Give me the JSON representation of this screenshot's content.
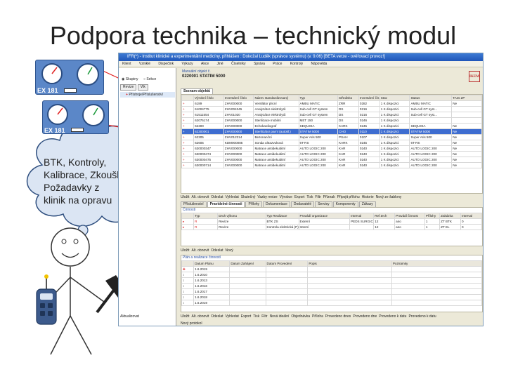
{
  "slide": {
    "title": "Podpora technika – technický modul",
    "cloud_lines": [
      "BTK, Kontroly,",
      "Kalibrace, Zkoušky,",
      "Požadavky z",
      "klinik na opravu"
    ]
  },
  "devices": [
    {
      "label": "EX 181"
    },
    {
      "label": "EX 181"
    }
  ],
  "colors": {
    "device_blue": "#5b87c8",
    "arrow_red": "#e02020",
    "selected_row": "#3e6dd0",
    "titlebar": "#1f55b8"
  },
  "app": {
    "title": "IFR(*) - Institut klinické a experimentální medicíny, přihlášen : Dokožal Luděk (správce systému) (v. 9.06) [BETA verze - ověřovací provoz!]",
    "menu": [
      "Klient",
      "Vzniklé",
      "Dispečink",
      "Výkazy",
      "Akce",
      "Jiné",
      "Číselníky",
      "Správa",
      "Práce",
      "Kontroly",
      "Nápověda"
    ],
    "radio_options": [
      "Skupiny",
      "Sekce"
    ],
    "left_tabs": [
      "Revize",
      "Vtk"
    ],
    "left_item": "Přístroje/Příslušenství",
    "header_label": "Manuální objekt č.",
    "header_value": "0220001 STATIM 5000",
    "logo_text": "IKEM",
    "upper_tab": "Seznam objektů",
    "upper_columns": [
      "Výrobní číslo",
      "Inventární číslo",
      "Název standardizovaný",
      "Typ",
      "Středisko",
      "Inventární čís.",
      "Stav",
      "Status",
      "TAss ZP"
    ],
    "upper_rows": [
      [
        "6189",
        "ZHV000000",
        "Ventilátor plicní",
        "AMBU MATIC",
        "ZRR",
        "0282",
        "1 K dispozici",
        "AMBU MATIC",
        "Ne"
      ],
      [
        "61004775",
        "ZHV004345",
        "Analyzátor elektrolytů",
        "Sub-cell GT system",
        "DS",
        "0216",
        "1 K dispozici",
        "Sub-cell GT syst...",
        ""
      ],
      [
        "61511554",
        "ZHV01020",
        "Analyzátor elektrolytů",
        "Sub-cell GT system",
        "DS",
        "0216",
        "1 K dispozici",
        "Sub-cell GT syst...",
        ""
      ],
      [
        "62075174",
        "ZHV000000",
        "Sterilizace mobilní",
        "MET 150",
        "DS",
        "0246",
        "1 K dispozici",
        "",
        ""
      ],
      [
        "62300",
        "ZHV000000",
        "Echokardiograf",
        "SEQUOIA",
        "KARK",
        "0245",
        "1 K dispozici",
        "SEQUOIA",
        "Ne"
      ],
      [
        "62300001",
        "ZHV000000",
        "Sterilizátor parní (autokl.)",
        "STATIM 5000",
        "CHO",
        "0110",
        "1 K dispozici",
        "STATIM 5000",
        "Ne"
      ],
      [
        "62305",
        "ZHV012314",
        "Bezonanční",
        "Super Aris 500",
        "PSAH",
        "0107",
        "1 K dispozici",
        "Super Aris 500",
        "Ne"
      ],
      [
        "62605",
        "KDM000085",
        "Sonda ultrazvuková",
        "6T-RS",
        "KARK",
        "0245",
        "1 K dispozici",
        "6T-RS",
        "Ne"
      ],
      [
        "630000347",
        "ZHV000000",
        "Matrace antidekubitní",
        "AUTO LOGIC 200",
        "KAR",
        "0240",
        "1 K dispozici",
        "AUTO LOGIC 200",
        "Ne"
      ],
      [
        "630000474",
        "ZHV000000",
        "Matrace antidekubitní",
        "AUTO LOGIC 200",
        "KAR",
        "0240",
        "1 K dispozici",
        "AUTO LOGIC 200",
        "Ne"
      ],
      [
        "630000475",
        "ZHV000000",
        "Matrace antidekubitní",
        "AUTO LOGIC 200",
        "KAR",
        "0240",
        "1 K dispozici",
        "AUTO LOGIC 200",
        "Ne"
      ],
      [
        "630000714",
        "ZHV000000",
        "Matrace antidekubitní",
        "AUTO LOGIC 200",
        "KAR",
        "0240",
        "1 K dispozici",
        "AUTO LOGIC 200",
        "Ne"
      ]
    ],
    "upper_selected": 5,
    "upper_toolbar": [
      "Uložit",
      "Alt. obnovit",
      "Odeslat",
      "Vyhledat",
      "Skutečný",
      "Vazby revize",
      "Výrobce",
      "Export",
      "Tisk",
      "Filtr",
      "Příznak",
      "Připojit přílohu",
      "Historie",
      "Nový ze šablony"
    ],
    "lower_tabs": [
      "Příslušenství",
      "Pravidelné činnosti",
      "Přílohy",
      "Dokumentace",
      "Dodavatelé",
      "Servisy",
      "Komponenty",
      "Zákazy"
    ],
    "lower_active_tab": 1,
    "lower_group": "Činnosti",
    "lower_columns": [
      "Typ",
      "Druh výkonu",
      "Typ Realizace",
      "Provádí organizace",
      "Interval",
      "Ref.tech",
      "Provádí činnost",
      "Přílohy",
      "Zakázka",
      "Interval"
    ],
    "lower_rows": [
      [
        "R",
        "Revize",
        "BTK ZS",
        "Externí",
        "PEDS SURGICAL s.r.o.",
        "12",
        "ano",
        "1",
        "ZT BTK",
        "0"
      ],
      [
        "R",
        "Revize",
        "Kontrola elektrická (P)",
        "Interní",
        "",
        "12",
        "ano",
        "1",
        "ZT EL",
        "0"
      ]
    ],
    "lower_toolbar": [
      "Uložit",
      "Alt. obnovit",
      "Odeslat",
      "Nový"
    ],
    "plan_group": "Plán a realizace činností",
    "plan_columns": [
      "Datum Plánu",
      "Datum Zahájení",
      "Datum Provedení",
      "Popis",
      "Poznámky"
    ],
    "plan_rows": [
      "1.6.2019",
      "1.6.2010",
      "1.6.2013",
      "1.6.2016",
      "1.6.2017",
      "1.6.2018",
      "1.6.2019"
    ],
    "plan_toolbar": [
      "Uložit",
      "Alt. obnovit",
      "Odeslat",
      "Vyhledat",
      "Export",
      "Tisk",
      "Filtr",
      "Nová ideální",
      "Objednávka",
      "Příloha",
      "Provedeno dnes",
      "Provedeno dne",
      "Provedeno k datu",
      "Provedeno k datu"
    ],
    "status": "Nový protokol",
    "left_status": "Aktualizovat"
  }
}
